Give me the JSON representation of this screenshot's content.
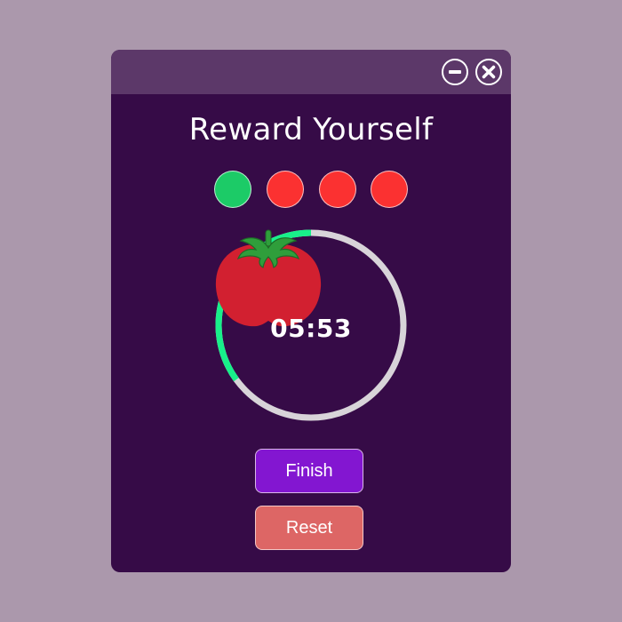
{
  "window": {
    "title": "Reward Yourself",
    "controls": {
      "minimize_icon": "minus-circle-icon",
      "close_icon": "x-circle-icon"
    }
  },
  "session_indicators": [
    {
      "status": "complete",
      "color": "#1ccb67"
    },
    {
      "status": "pending",
      "color": "#fb3131"
    },
    {
      "status": "pending",
      "color": "#fb3131"
    },
    {
      "status": "pending",
      "color": "#fb3131"
    }
  ],
  "timer": {
    "display": "05:53",
    "progress_fraction": 0.35,
    "progress_color": "#18f08a",
    "track_color": "#d8d4d9",
    "icon": "tomato-icon"
  },
  "actions": {
    "finish_label": "Finish",
    "reset_label": "Reset"
  },
  "colors": {
    "background": "#ab98ac",
    "window": "#360b47",
    "titlebar": "#5c3869",
    "finish_button": "#8316d1",
    "reset_button": "#dd6665"
  }
}
